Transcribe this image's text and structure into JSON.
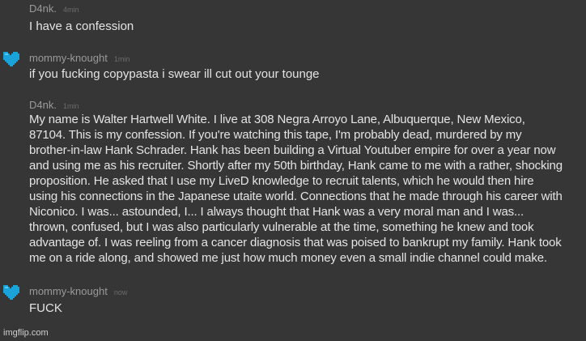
{
  "messages": [
    {
      "author": "D4nk.",
      "time": "4min",
      "text": "I have a confession",
      "avatar": null
    },
    {
      "author": "mommy-knought",
      "time": "1min",
      "text": "if you fucking copypasta i swear ill cut out your tounge",
      "avatar": "blue-pixel-heart-icon"
    },
    {
      "author": "D4nk.",
      "time": "1min",
      "text": "My name is Walter Hartwell White. I live at 308 Negra Arroyo Lane, Albuquerque, New Mexico,\n87104. This is my confession. If you're watching this tape, I'm probably dead, murdered by my\nbrother-in-law Hank Schrader. Hank has been building a Virtual Youtuber empire for over a year now\nand using me as his recruiter. Shortly after my 50th birthday, Hank came to me with a rather, shocking\nproposition. He asked that I use my LiveD knowledge to recruit talents, which he would then hire\nusing his connections in the Japanese utaite world. Connections that he made through his career with\nNiconico. I was... astounded, I... I always thought that Hank was a very moral man and I was...\nthrown, confused, but I was also particularly vulnerable at the time, something he knew and took\nadvantage of. I was reeling from a cancer diagnosis that was poised to bankrupt my family. Hank took\nme on a ride along, and showed me just how much money even a small indie channel could make.",
      "avatar": null
    },
    {
      "author": "mommy-knought",
      "time": "now",
      "text": "FUCK",
      "avatar": "blue-pixel-heart-icon"
    }
  ],
  "watermark": "imgflip.com",
  "colors": {
    "background": "#363636",
    "author": "#9a9a9a",
    "timestamp": "#6c6c6c",
    "text": "#e4e4e4",
    "avatar": "#1aa3d9"
  }
}
